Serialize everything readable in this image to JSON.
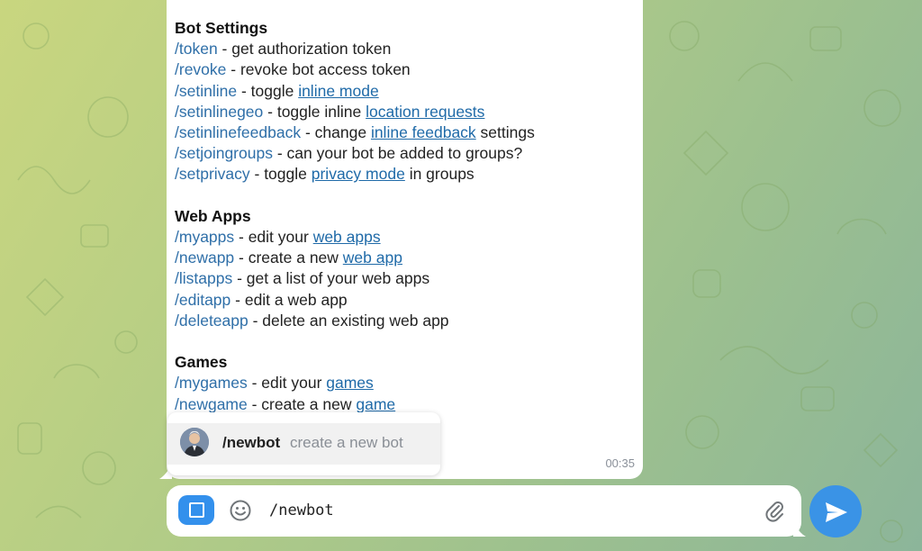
{
  "message": {
    "sections": [
      {
        "title": "Bot Settings",
        "lines": [
          [
            {
              "t": "/token",
              "k": "cmd"
            },
            {
              "t": " - get authorization token",
              "k": "text"
            }
          ],
          [
            {
              "t": "/revoke",
              "k": "cmd"
            },
            {
              "t": " - revoke bot access token",
              "k": "text"
            }
          ],
          [
            {
              "t": "/setinline",
              "k": "cmd"
            },
            {
              "t": " - toggle ",
              "k": "text"
            },
            {
              "t": "inline mode",
              "k": "link"
            }
          ],
          [
            {
              "t": "/setinlinegeo",
              "k": "cmd"
            },
            {
              "t": " - toggle inline ",
              "k": "text"
            },
            {
              "t": "location requests",
              "k": "link"
            }
          ],
          [
            {
              "t": "/setinlinefeedback",
              "k": "cmd"
            },
            {
              "t": " - change ",
              "k": "text"
            },
            {
              "t": "inline feedback",
              "k": "link"
            },
            {
              "t": " settings",
              "k": "text"
            }
          ],
          [
            {
              "t": "/setjoingroups",
              "k": "cmd"
            },
            {
              "t": " - can your bot be added to groups?",
              "k": "text"
            }
          ],
          [
            {
              "t": "/setprivacy",
              "k": "cmd"
            },
            {
              "t": " - toggle ",
              "k": "text"
            },
            {
              "t": "privacy mode",
              "k": "link"
            },
            {
              "t": " in groups",
              "k": "text"
            }
          ]
        ]
      },
      {
        "title": "Web Apps",
        "lines": [
          [
            {
              "t": "/myapps",
              "k": "cmd"
            },
            {
              "t": " - edit your ",
              "k": "text"
            },
            {
              "t": "web apps",
              "k": "link"
            }
          ],
          [
            {
              "t": "/newapp",
              "k": "cmd"
            },
            {
              "t": " - create a new ",
              "k": "text"
            },
            {
              "t": "web app",
              "k": "link"
            }
          ],
          [
            {
              "t": "/listapps",
              "k": "cmd"
            },
            {
              "t": " - get a list of your web apps",
              "k": "text"
            }
          ],
          [
            {
              "t": "/editapp",
              "k": "cmd"
            },
            {
              "t": " - edit a web app",
              "k": "text"
            }
          ],
          [
            {
              "t": "/deleteapp",
              "k": "cmd"
            },
            {
              "t": " - delete an existing web app",
              "k": "text"
            }
          ]
        ]
      },
      {
        "title": "Games",
        "lines": [
          [
            {
              "t": "/mygames",
              "k": "cmd"
            },
            {
              "t": " - edit your ",
              "k": "text"
            },
            {
              "t": "games",
              "k": "link"
            }
          ],
          [
            {
              "t": "/newgame",
              "k": "cmd"
            },
            {
              "t": " - create a new ",
              "k": "text"
            },
            {
              "t": "game",
              "k": "link"
            }
          ]
        ]
      }
    ],
    "partially_hidden_text": "e",
    "time": "00:35"
  },
  "suggestion": {
    "command": "/newbot",
    "description": "create a new bot"
  },
  "composer": {
    "input_value": "/newbot"
  },
  "colors": {
    "command": "#2f6fa8",
    "link": "#1f6aa8",
    "accent": "#3390ec",
    "send": "#3a93e6"
  },
  "icons": {
    "menu": "bot-menu-icon",
    "emoji": "smiley-icon",
    "attach": "paperclip-icon",
    "send": "paper-plane-icon"
  }
}
